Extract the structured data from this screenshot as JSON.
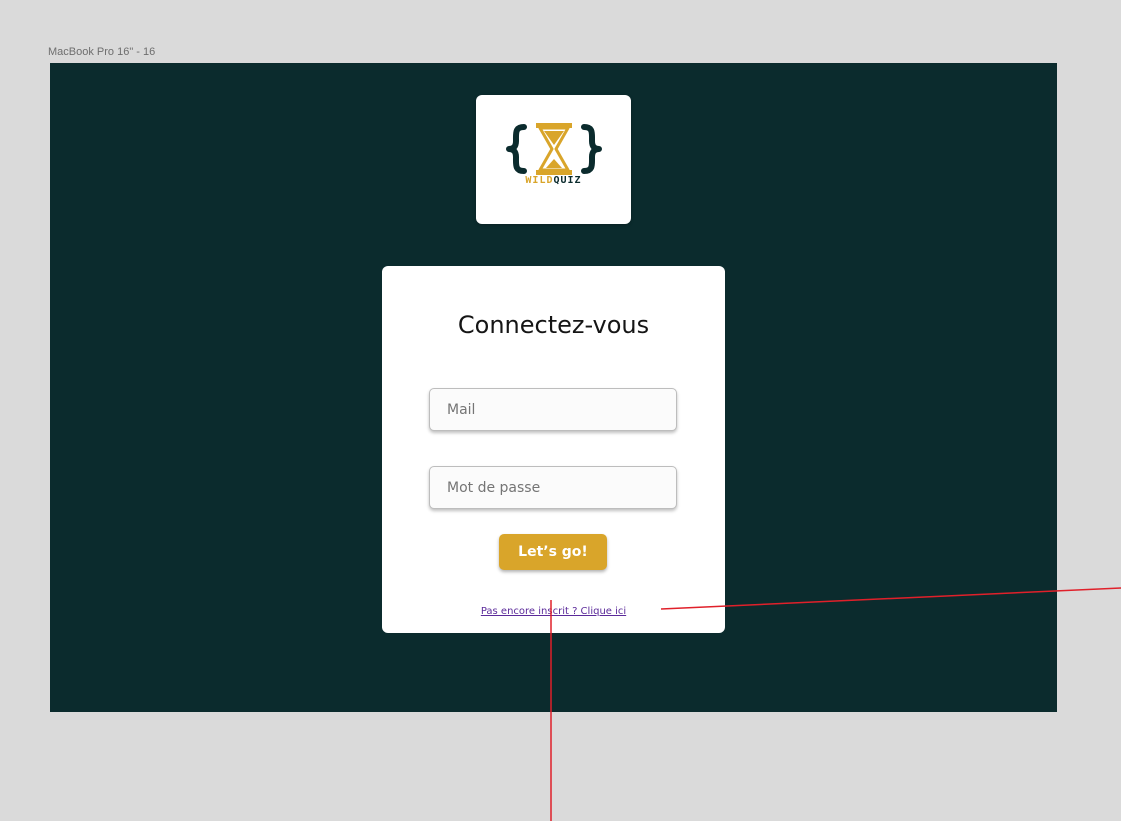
{
  "artboard": {
    "label": "MacBook Pro 16\" - 16",
    "background_color": "#0b2b2d"
  },
  "logo": {
    "icon": "hourglass-braces-icon",
    "brand_part1": "WILD",
    "brand_part2": "QUIZ",
    "accent_color": "#d9a52a"
  },
  "login": {
    "title": "Connectez-vous",
    "mail_placeholder": "Mail",
    "password_placeholder": "Mot de passe",
    "submit_label": "Let’s go!",
    "signup_link": "Pas encore inscrit ? Clique ici",
    "button_color": "#d9a52a",
    "link_color": "#5b2a9a"
  },
  "annotation": {
    "line_color": "#e0202a"
  }
}
